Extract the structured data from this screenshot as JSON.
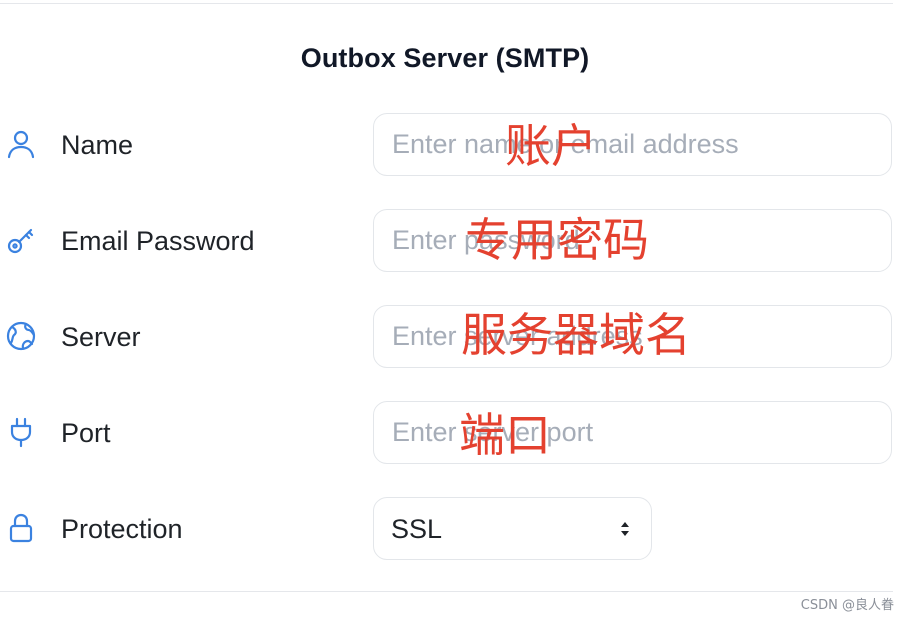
{
  "section": {
    "title": "Outbox Server (SMTP)"
  },
  "fields": {
    "name": {
      "label": "Name",
      "placeholder": "Enter name or email address",
      "value": "",
      "icon": "user-icon"
    },
    "password": {
      "label": "Email Password",
      "placeholder": "Enter password",
      "value": "",
      "icon": "key-icon"
    },
    "server": {
      "label": "Server",
      "placeholder": "Enter server address",
      "value": "",
      "icon": "globe-icon"
    },
    "port": {
      "label": "Port",
      "placeholder": "Enter server port",
      "value": "",
      "icon": "plug-icon"
    },
    "protection": {
      "label": "Protection",
      "selected": "SSL",
      "icon": "lock-icon"
    }
  },
  "annotations": {
    "account": "账户",
    "app_password": "专用密码",
    "server_domain": "服务器域名",
    "port": "端口"
  },
  "watermark": "CSDN @良人眷",
  "colors": {
    "icon": "#3b82e0",
    "annotation": "#e4412f",
    "placeholder": "#a6adb8",
    "border": "#e3e6ea"
  }
}
